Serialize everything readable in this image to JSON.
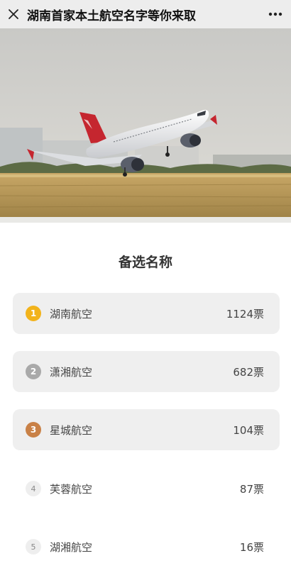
{
  "header": {
    "title": "湖南首家本土航空名字等你来取",
    "close_icon": "close-icon",
    "more_icon": "more-icon"
  },
  "hero": {
    "image": "airplane-takeoff-photo"
  },
  "section": {
    "title": "备选名称"
  },
  "options": [
    {
      "rank": "1",
      "name": "湖南航空",
      "votes": "1124票",
      "badge_color": "#f2b31b"
    },
    {
      "rank": "2",
      "name": "潇湘航空",
      "votes": "682票",
      "badge_color": "#a9a9a9"
    },
    {
      "rank": "3",
      "name": "星城航空",
      "votes": "104票",
      "badge_color": "#c98147"
    },
    {
      "rank": "4",
      "name": "芙蓉航空",
      "votes": "87票"
    },
    {
      "rank": "5",
      "name": "湖湘航空",
      "votes": "16票"
    }
  ]
}
